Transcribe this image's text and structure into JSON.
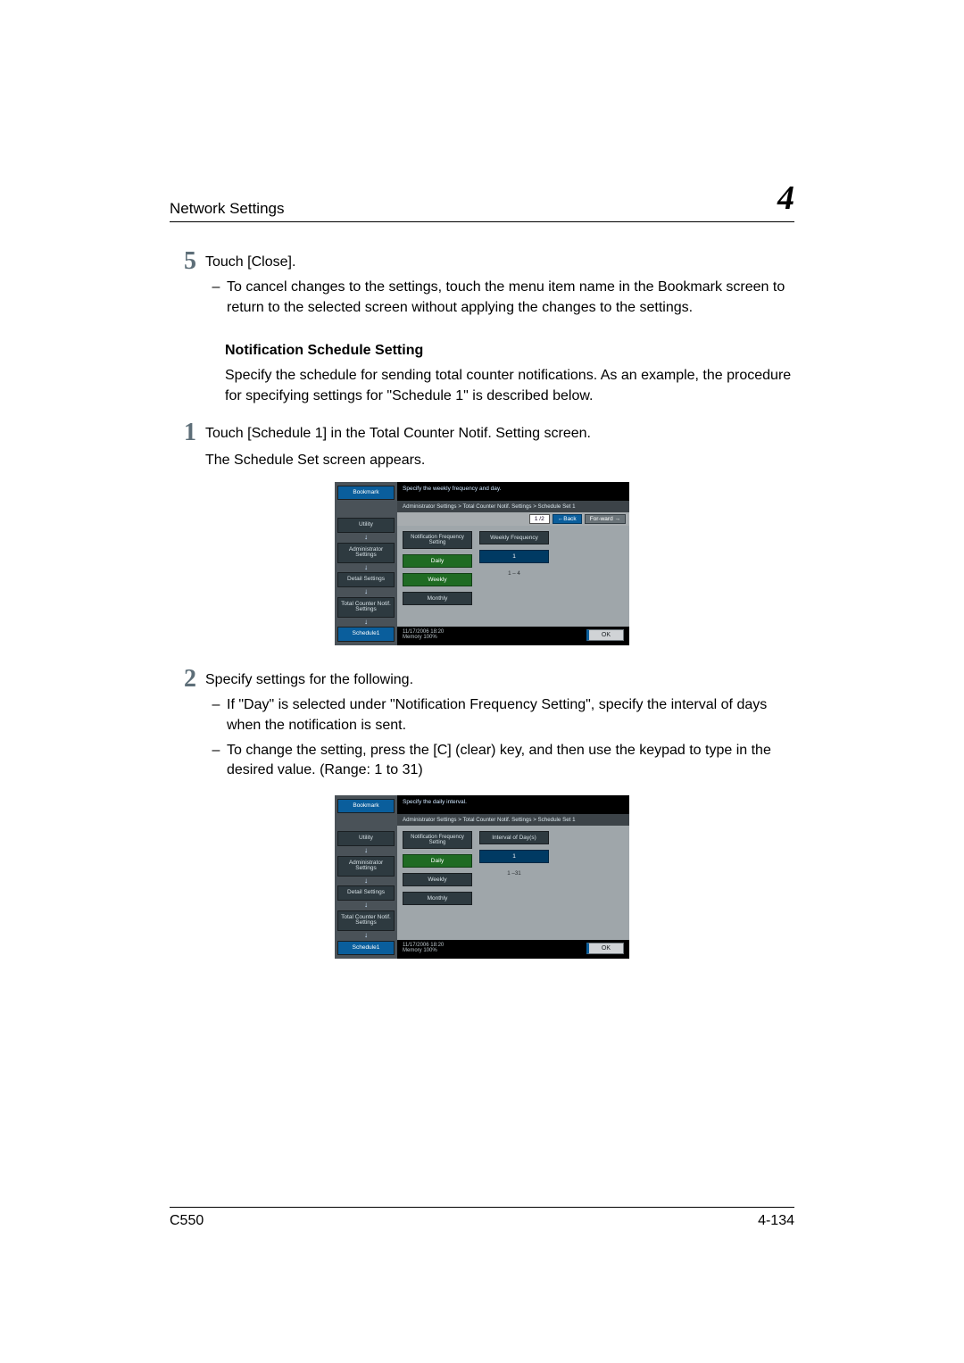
{
  "header": {
    "title": "Network Settings",
    "chapter": "4"
  },
  "footer": {
    "left": "C550",
    "right": "4-134"
  },
  "step5": {
    "num": "5",
    "text": "Touch [Close].",
    "bullet": "To cancel changes to the settings, touch the menu item name in the Bookmark screen to return to the selected screen without applying the changes to the settings."
  },
  "subheading": "Notification Schedule Setting",
  "intro": "Specify the schedule for sending total counter notifications. As an example, the procedure for specifying settings for \"Schedule 1\" is described below.",
  "step1": {
    "num": "1",
    "text": "Touch [Schedule 1] in the Total Counter Notif. Setting screen.",
    "after": "The Schedule Set screen appears."
  },
  "step2": {
    "num": "2",
    "text": "Specify settings for the following.",
    "b1": "If \"Day\" is selected under \"Notification Frequency Setting\", specify the interval of days when the notification is sent.",
    "b2": "To change the setting, press the [C] (clear) key, and then use the keypad to type in the desired value. (Range: 1 to 31)"
  },
  "device_common": {
    "sidebar": {
      "bookmark": "Bookmark",
      "utility": "Utility",
      "admin": "Administrator Settings",
      "detail": "Detail Settings",
      "tcn": "Total Counter Notif. Settings",
      "schedule": "Schedule1"
    },
    "col1_label": "Notification Frequency Setting",
    "opts": {
      "daily": "Daily",
      "weekly": "Weekly",
      "monthly": "Monthly"
    },
    "breadcrumb": "Administrator Settings > Total Counter Notif. Settings > Schedule Set 1",
    "footer": {
      "datetime": "11/17/2006   18:20",
      "memory": "Memory      100%",
      "ok": "OK"
    }
  },
  "device1": {
    "instruction": "Specify the weekly frequency and day.",
    "page": "1 /2",
    "back": "←Back",
    "fwd": "For-ward →",
    "col2_label": "Weekly Frequency",
    "value": "1",
    "range": "1 – 4"
  },
  "device2": {
    "instruction": "Specify the daily interval.",
    "col2_label": "Interval of Day(s)",
    "value": "1",
    "range": "1 –31"
  }
}
